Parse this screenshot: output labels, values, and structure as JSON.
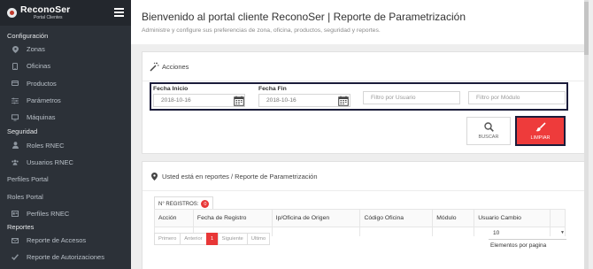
{
  "brand": {
    "name": "ReconoSer",
    "subtitle": "Portal Clientes"
  },
  "sidebar": {
    "sections": [
      {
        "label": "Configuración"
      },
      {
        "label": "Seguridad"
      },
      {
        "label": "Reportes"
      }
    ],
    "items": [
      {
        "label": "Zonas",
        "icon": "map-marker-icon"
      },
      {
        "label": "Oficinas",
        "icon": "mobile-icon"
      },
      {
        "label": "Productos",
        "icon": "credit-card-icon"
      },
      {
        "label": "Parámetros",
        "icon": "sliders-icon"
      },
      {
        "label": "Máquinas",
        "icon": "desktop-icon"
      },
      {
        "label": "Roles RNEC",
        "icon": "user-icon"
      },
      {
        "label": "Usuarios RNEC",
        "icon": "users-icon"
      },
      {
        "label": "Perfiles Portal"
      },
      {
        "label": "Roles Portal"
      },
      {
        "label": "Perfiles RNEC",
        "icon": "id-card-icon"
      },
      {
        "label": "Reporte de Accesos",
        "icon": "envelope-icon"
      },
      {
        "label": "Reporte de Autorizaciones",
        "icon": "check-icon"
      }
    ]
  },
  "header": {
    "title": "Bienvenido al portal cliente ReconoSer | Reporte de Parametrización",
    "subtitle": "Administre y configure sus preferencias de zona, oficina, productos, seguridad y reportes."
  },
  "actions": {
    "title": "Acciones",
    "fecha_inicio_label": "Fecha Inicio",
    "fecha_inicio_value": "2018-10-16",
    "fecha_fin_label": "Fecha Fin",
    "fecha_fin_value": "2018-10-16",
    "usuario_placeholder": "Filtro por Usuario",
    "modulo_placeholder": "Filtro por Módulo",
    "buscar_label": "BUSCAR",
    "limpiar_label": "LIMPIAR"
  },
  "report": {
    "breadcrumb": "Usted está en reportes / Reporte de Parametrización",
    "registros_label": "N° REGISTROS:",
    "registros_count": "0",
    "columns": [
      "Acción",
      "Fecha de Registro",
      "Ip/Oficina de Origen",
      "Código Oficina",
      "Módulo",
      "Usuario Cambio"
    ],
    "pager": {
      "first": "Primero",
      "prev": "Anterior",
      "current": "1",
      "next": "Siguiente",
      "last": "Ultimo"
    },
    "page_size": "10",
    "page_size_caption": "Elementos por pagina"
  },
  "colors": {
    "sidebar": "#2c3138",
    "accent": "#ee3b3b",
    "highlight_border": "#1b1c3a"
  }
}
